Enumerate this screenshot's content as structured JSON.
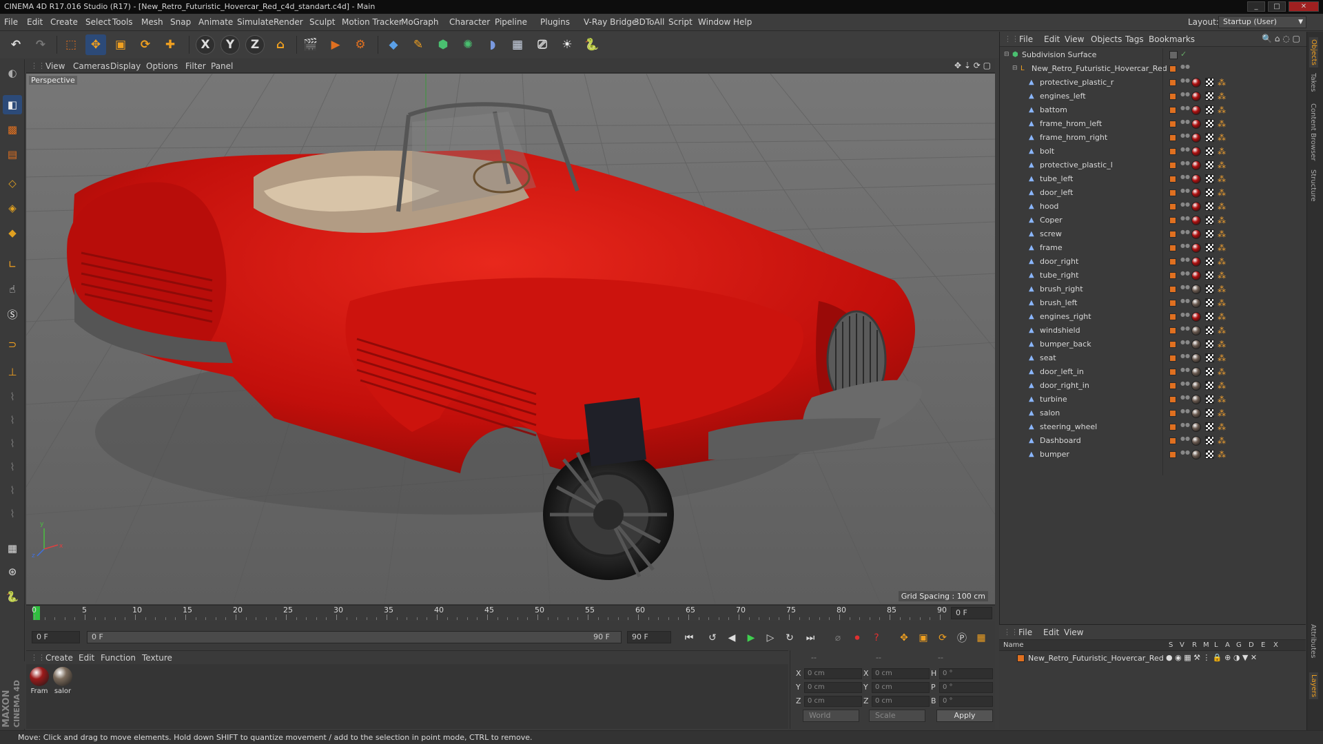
{
  "window": {
    "title": "CINEMA 4D R17.016 Studio (R17) - [New_Retro_Futuristic_Hovercar_Red_c4d_standart.c4d] - Main"
  },
  "menu": [
    "File",
    "Edit",
    "Create",
    "Select",
    "Tools",
    "Mesh",
    "Snap",
    "Animate",
    "Simulate",
    "Render",
    "Sculpt",
    "Motion Tracker",
    "MoGraph",
    "Character",
    "Pipeline",
    "Plugins",
    "V-Ray Bridge",
    "3DToAll",
    "Script",
    "Window",
    "Help"
  ],
  "layout": {
    "label": "Layout:",
    "value": "Startup (User)"
  },
  "viewport": {
    "menu": [
      "View",
      "Cameras",
      "Display",
      "Options",
      "Filter",
      "Panel"
    ],
    "label": "Perspective",
    "grid_spacing": "Grid Spacing : 100 cm"
  },
  "timeline": {
    "ticks": [
      "0",
      "5",
      "10",
      "15",
      "20",
      "25",
      "30",
      "35",
      "40",
      "45",
      "50",
      "55",
      "60",
      "65",
      "70",
      "75",
      "80",
      "85",
      "90"
    ],
    "frame_display": "0 F"
  },
  "playbar": {
    "start": "0 F",
    "range_left": "0 F",
    "range_right": "90 F",
    "end": "90 F"
  },
  "materials": {
    "menu": [
      "Create",
      "Edit",
      "Function",
      "Texture"
    ],
    "items": [
      {
        "label": "Fram",
        "color": "#9b1a1a"
      },
      {
        "label": "salor",
        "color": "#7a6a5a"
      }
    ]
  },
  "coords": {
    "header": [
      "--",
      "--",
      "--"
    ],
    "rows": [
      {
        "a": "X",
        "av": "0 cm",
        "b": "X",
        "bv": "0 cm",
        "c": "H",
        "cv": "0 °"
      },
      {
        "a": "Y",
        "av": "0 cm",
        "b": "Y",
        "bv": "0 cm",
        "c": "P",
        "cv": "0 °"
      },
      {
        "a": "Z",
        "av": "0 cm",
        "b": "Z",
        "bv": "0 cm",
        "c": "B",
        "cv": "0 °"
      }
    ],
    "world": "World",
    "scale": "Scale",
    "apply": "Apply"
  },
  "objects": {
    "menu": [
      "File",
      "Edit",
      "View",
      "Objects",
      "Tags",
      "Bookmarks"
    ],
    "root": "Subdivision Surface",
    "group": "New_Retro_Futuristic_Hovercar_Red",
    "children": [
      "protective_plastic_r",
      "engines_left",
      "battom",
      "frame_hrom_left",
      "frame_hrom_right",
      "bolt",
      "protective_plastic_l",
      "tube_left",
      "door_left",
      "hood",
      "Coper",
      "screw",
      "frame",
      "door_right",
      "tube_right",
      "brush_right",
      "brush_left",
      "engines_right",
      "windshield",
      "bumper_back",
      "seat",
      "door_left_in",
      "door_right_in",
      "turbine",
      "salon",
      "steering_wheel",
      "Dashboard",
      "bumper"
    ]
  },
  "layers": {
    "menu": [
      "File",
      "Edit",
      "View"
    ],
    "columns": [
      "Name",
      "S",
      "V",
      "R",
      "M",
      "L",
      "A",
      "G",
      "D",
      "E",
      "X"
    ],
    "row": "New_Retro_Futuristic_Hovercar_Red"
  },
  "right_tabs": [
    "Objects",
    "Takes",
    "Content Browser",
    "Structure",
    "Attributes",
    "Layers"
  ],
  "status": "Move: Click and drag to move elements. Hold down SHIFT to quantize movement / add to the selection in point mode, CTRL to remove.",
  "brand": {
    "line1": "MAXON",
    "line2": "CINEMA 4D"
  },
  "colors": {
    "accent_orange": "#e07020",
    "car_red": "#c4100d",
    "viewport_bg": "#6b6b6b"
  }
}
